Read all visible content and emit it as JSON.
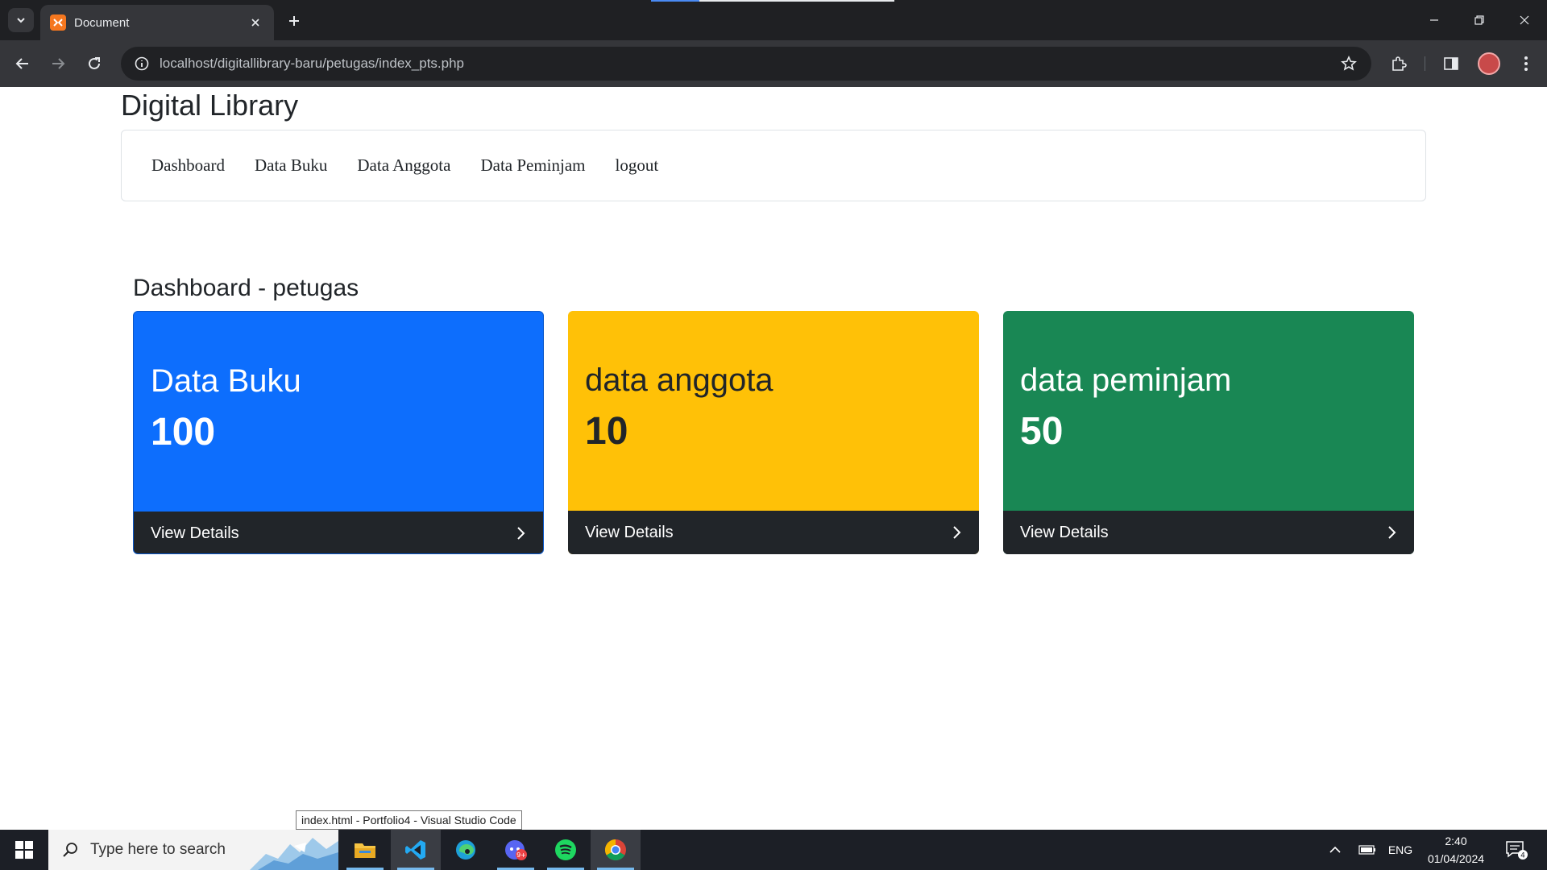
{
  "browser": {
    "tab_title": "Document",
    "url": "localhost/digitallibrary-baru/petugas/index_pts.php"
  },
  "page": {
    "brand": "Digital Library",
    "nav": [
      "Dashboard",
      "Data Buku",
      "Data Anggota",
      "Data Peminjam",
      "logout"
    ],
    "section_title": "Dashboard - petugas",
    "cards": [
      {
        "title": "Data Buku",
        "value": "100",
        "footer": "View Details",
        "color": "#0d6efd"
      },
      {
        "title": "data anggota",
        "value": "10",
        "footer": "View Details",
        "color": "#ffc107"
      },
      {
        "title": "data peminjam",
        "value": "50",
        "footer": "View Details",
        "color": "#198754"
      }
    ]
  },
  "tooltip": "index.html - Portfolio4 - Visual Studio Code",
  "taskbar": {
    "search_placeholder": "Type here to search",
    "apps": [
      "file-explorer-icon",
      "vscode-icon",
      "edge-icon",
      "discord-icon",
      "spotify-icon",
      "chrome-icon"
    ],
    "discord_badge": "9+",
    "language": "ENG",
    "time": "2:40",
    "date": "01/04/2024",
    "notification_count": "4"
  }
}
